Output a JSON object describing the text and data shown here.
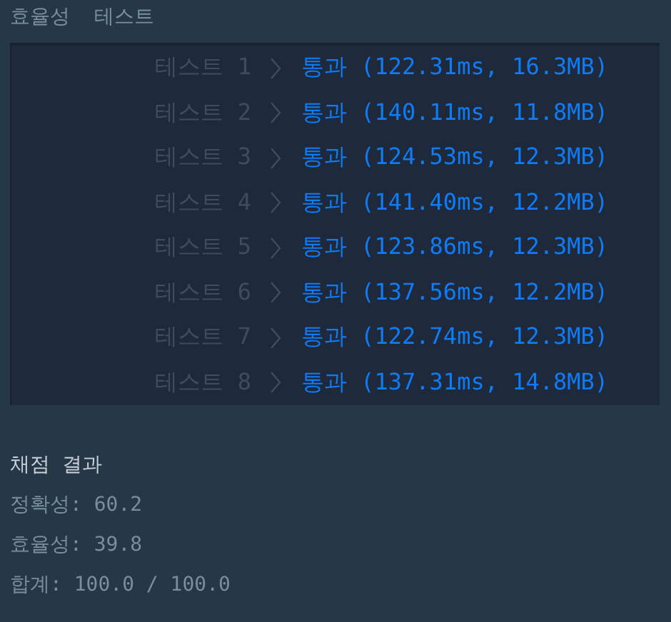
{
  "section_title": "효율성  테스트",
  "tests": [
    {
      "label": "테스트 1",
      "kind": "pass",
      "result": "통과 (122.31ms, 16.3MB)"
    },
    {
      "label": "테스트 2",
      "kind": "pass",
      "result": "통과 (140.11ms, 11.8MB)"
    },
    {
      "label": "테스트 3",
      "kind": "pass",
      "result": "통과 (124.53ms, 12.3MB)"
    },
    {
      "label": "테스트 4",
      "kind": "pass",
      "result": "통과 (141.40ms, 12.2MB)"
    },
    {
      "label": "테스트 5",
      "kind": "pass",
      "result": "통과 (123.86ms, 12.3MB)"
    },
    {
      "label": "테스트 6",
      "kind": "pass",
      "result": "통과 (137.56ms, 12.2MB)"
    },
    {
      "label": "테스트 7",
      "kind": "pass",
      "result": "통과 (122.74ms, 12.3MB)"
    },
    {
      "label": "테스트 8",
      "kind": "pass",
      "result": "통과 (137.31ms, 14.8MB)"
    }
  ],
  "grading": {
    "title": "채점 결과",
    "lines": [
      "정확성: 60.2",
      "효율성: 39.8",
      "합계: 100.0 / 100.0"
    ]
  }
}
